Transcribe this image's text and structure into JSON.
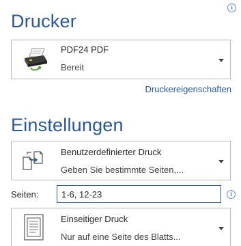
{
  "printer": {
    "title": "Drucker",
    "name": "PDF24 PDF",
    "status": "Bereit",
    "properties_link": "Druckereigenschaften"
  },
  "settings": {
    "title": "Einstellungen",
    "print_range": {
      "label": "Benutzerdefinierter Druck",
      "description": "Geben Sie bestimmte Seiten,..."
    },
    "pages": {
      "label": "Seiten:",
      "value": "1-6, 12-23"
    },
    "sides": {
      "label": "Einseitiger Druck",
      "description": "Nur auf eine Seite des Blatts..."
    }
  },
  "icons": {
    "info": "info-icon",
    "printer": "printer-icon",
    "custom_print": "custom-print-icon",
    "one_sided": "one-sided-page-icon",
    "caret": "chevron-down-icon"
  },
  "colors": {
    "accent": "#2b579a",
    "border": "#b8b8b8"
  }
}
